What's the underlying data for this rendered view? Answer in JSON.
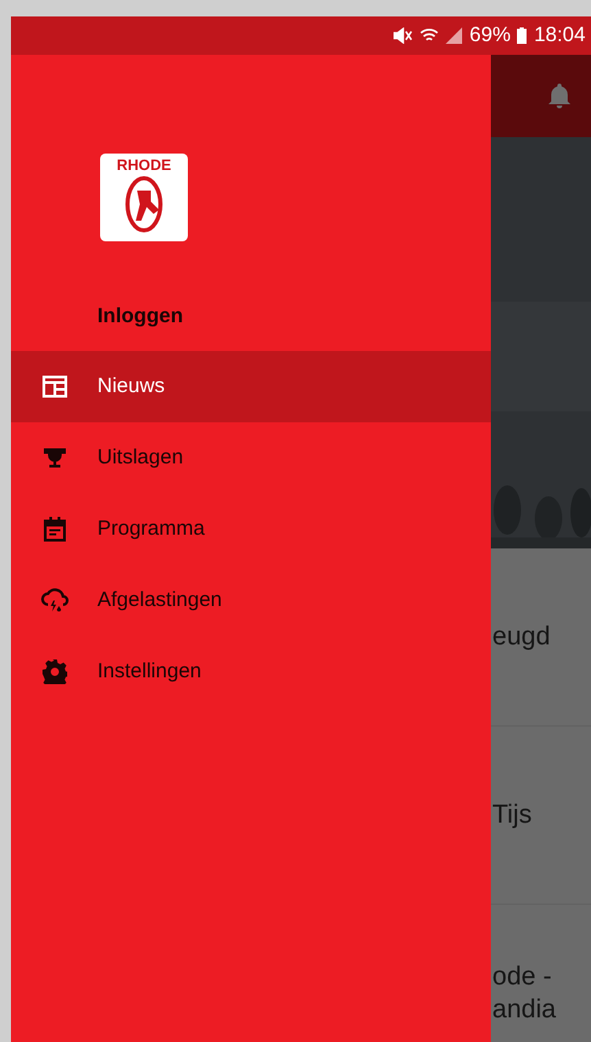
{
  "status_bar": {
    "battery": "69%",
    "time": "18:04"
  },
  "background": {
    "news_items": [
      {
        "lines": [
          "eugd"
        ]
      },
      {
        "lines": [
          "Tijs"
        ]
      },
      {
        "lines": [
          "ode -",
          "andia"
        ]
      }
    ]
  },
  "drawer": {
    "logo_text": "RHODE",
    "login": "Inloggen",
    "items": [
      {
        "kind": "news",
        "label": "Nieuws",
        "selected": true
      },
      {
        "kind": "results",
        "label": "Uitslagen",
        "selected": false
      },
      {
        "kind": "schedule",
        "label": "Programma",
        "selected": false
      },
      {
        "kind": "cancellations",
        "label": "Afgelastingen",
        "selected": false
      },
      {
        "kind": "settings",
        "label": "Instellingen",
        "selected": false
      }
    ]
  }
}
